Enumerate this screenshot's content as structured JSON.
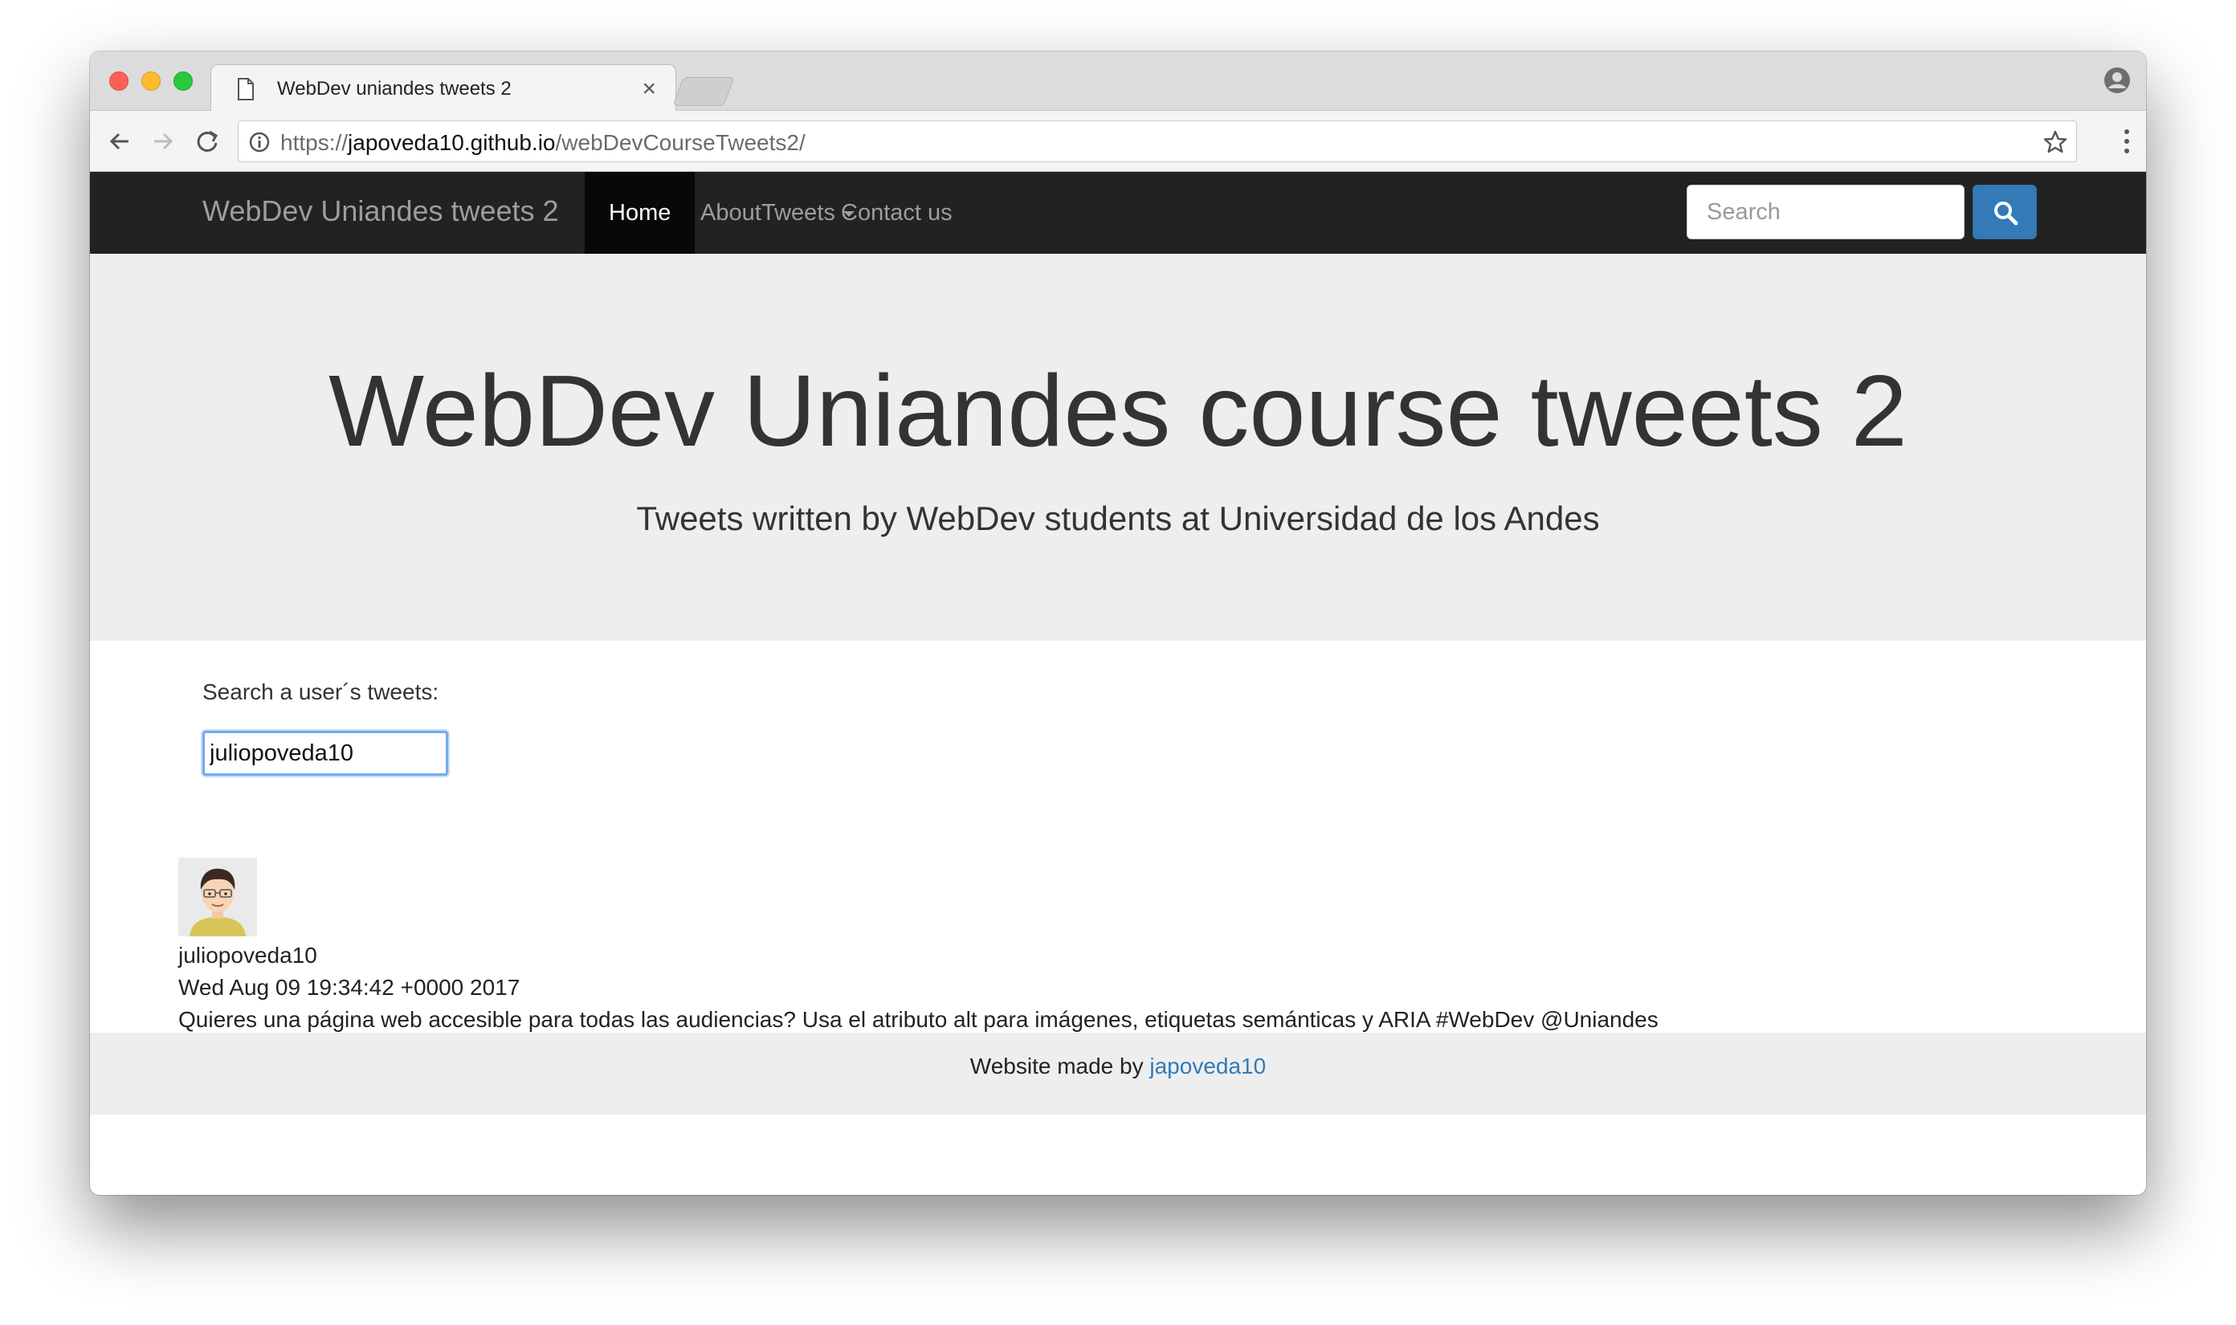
{
  "browser": {
    "tab_title": "WebDev uniandes tweets 2",
    "tab_close": "×",
    "url_scheme": "https://",
    "url_host": "japoveda10.github.io",
    "url_path": "/webDevCourseTweets2/"
  },
  "navbar": {
    "brand": "WebDev Uniandes tweets 2",
    "items": [
      {
        "label": "Home",
        "active": true
      },
      {
        "label": "About"
      },
      {
        "label": "Tweets"
      },
      {
        "label": "Contact us"
      }
    ],
    "search_placeholder": "Search"
  },
  "jumbotron": {
    "title": "WebDev Uniandes course tweets 2",
    "subtitle": "Tweets written by WebDev students at Universidad de los Andes"
  },
  "search": {
    "label": "Search a user´s tweets:",
    "value": "juliopoveda10"
  },
  "tweet": {
    "user": "juliopoveda10",
    "date": "Wed Aug 09 19:34:42 +0000 2017",
    "text": "Quieres una página web accesible para todas las audiencias? Usa el atributo alt para imágenes, etiquetas semánticas y ARIA #WebDev @Uniandes"
  },
  "footer": {
    "prefix": "Website made by ",
    "link_text": "japoveda10"
  },
  "colors": {
    "navbar_bg": "#222222",
    "accent": "#337ab7",
    "jumbotron_bg": "#eeeeee"
  }
}
